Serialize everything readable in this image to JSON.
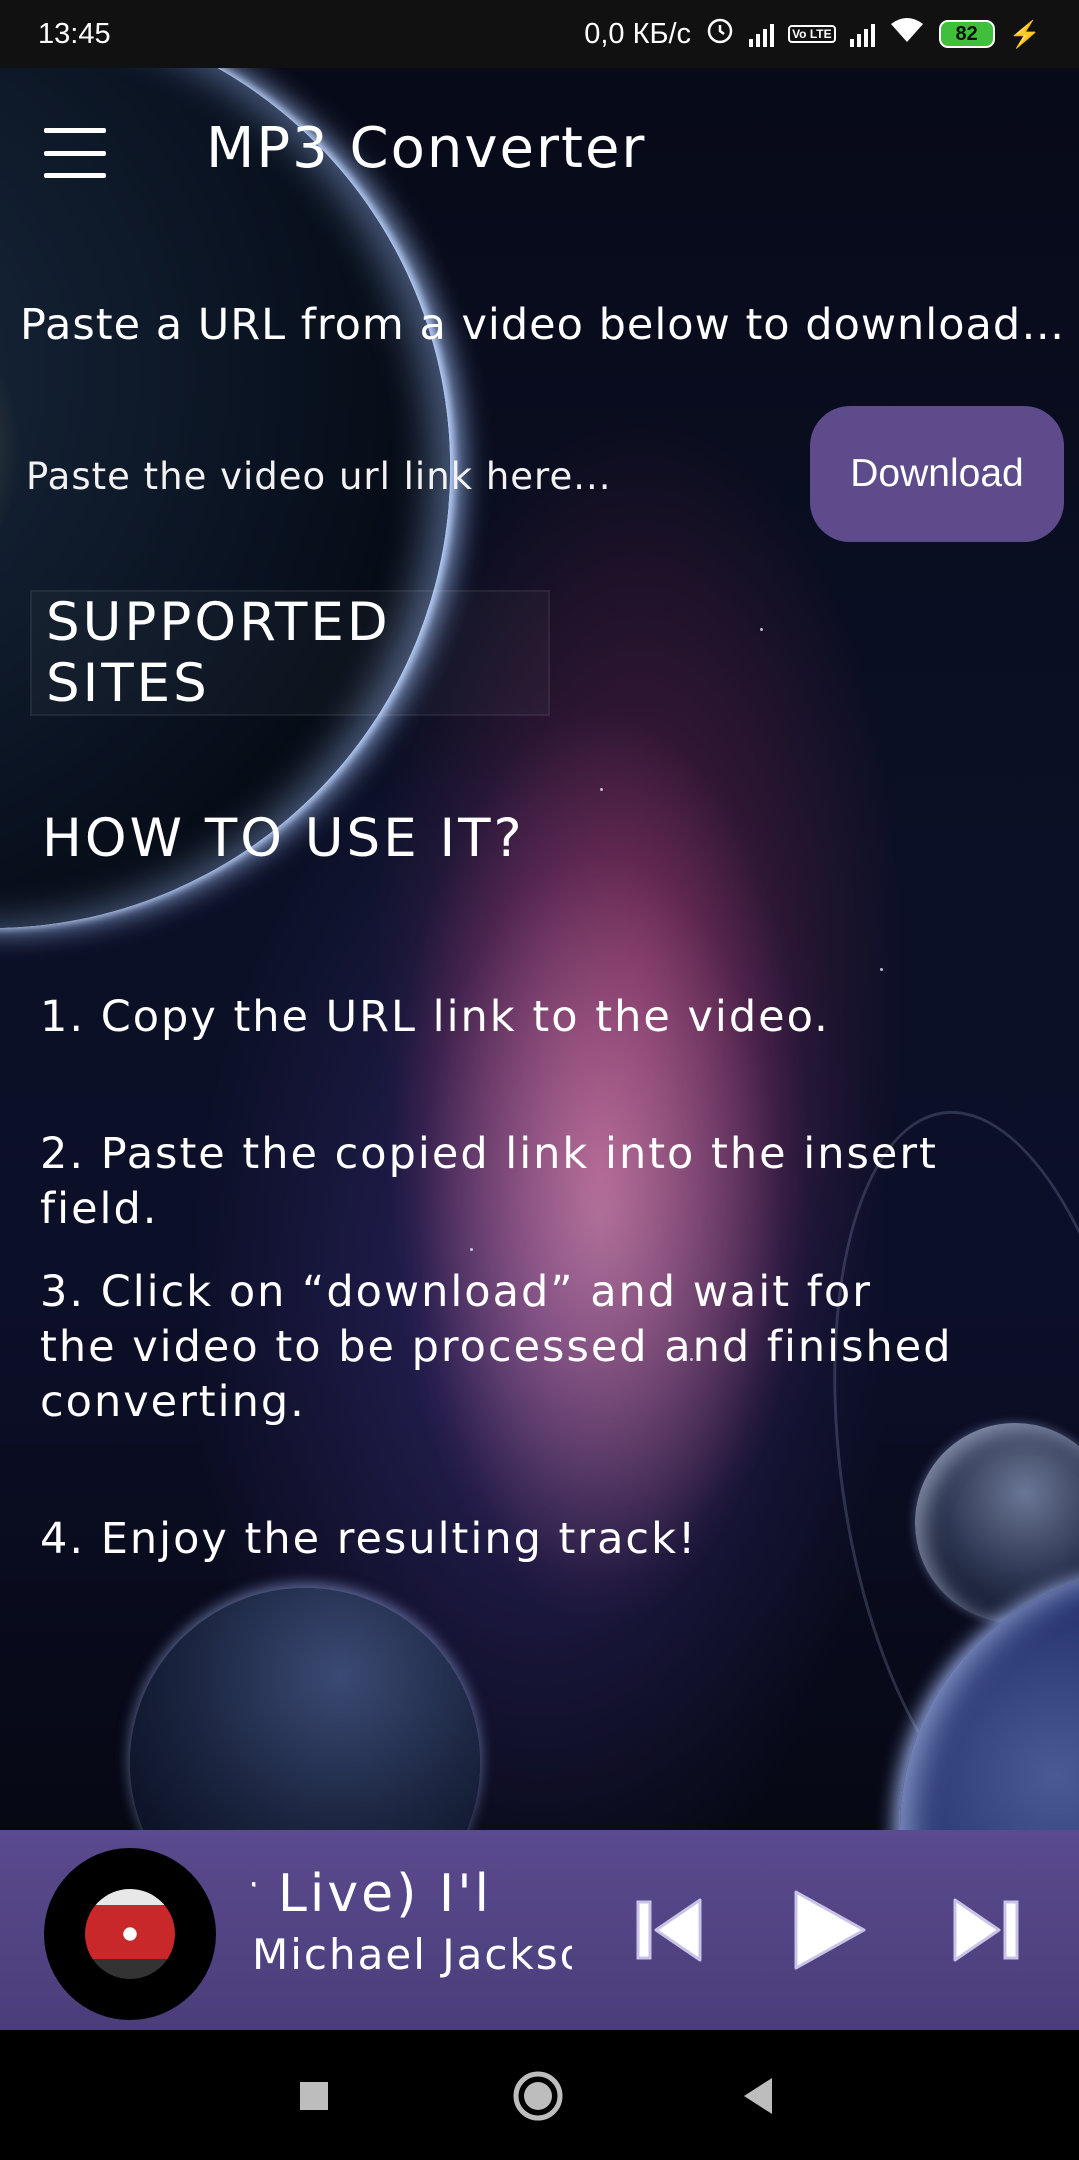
{
  "status_bar": {
    "time": "13:45",
    "net_speed": "0,0 КБ/с",
    "volte": "Vo LTE",
    "battery": "82"
  },
  "app_bar": {
    "title": "MP3 Converter",
    "menu_icon": "hamburger-menu-icon"
  },
  "main": {
    "intro": "Paste a URL from a video below to download i..",
    "url_placeholder": "Paste the video url link here...",
    "url_value": "",
    "download_label": "Download",
    "supported_sites": "SUPPORTED SITES",
    "how_to_title": "HOW TO USE IT?",
    "steps": [
      "1. Copy the URL link to the video.",
      "2. Paste the copied link into the insert field.",
      "3. Click on “download” and wait for",
      "the video to be processed and finished",
      "converting.",
      "4. Enjoy the resulting track!"
    ]
  },
  "player": {
    "title": "r Live)      I'l",
    "artist": "Michael Jackson",
    "controls": [
      "skip-previous-icon",
      "play-icon",
      "skip-next-icon"
    ],
    "accent": "#5e4b8b"
  },
  "nav_bar": {
    "buttons": [
      "recents-square-icon",
      "home-circle-icon",
      "back-triangle-icon"
    ]
  }
}
